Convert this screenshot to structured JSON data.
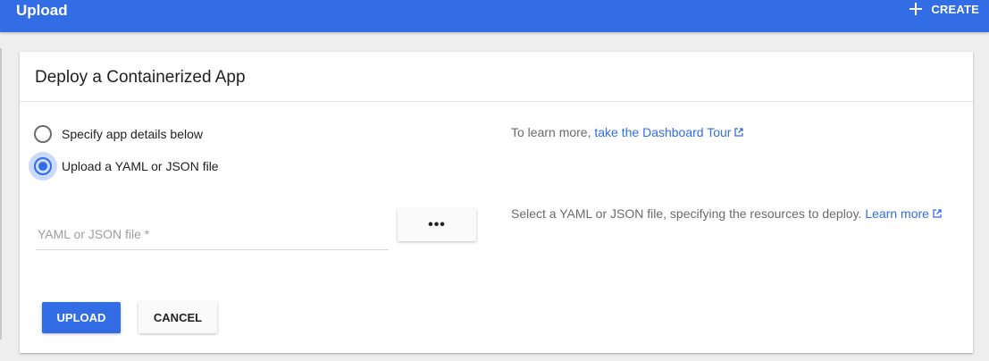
{
  "header": {
    "title": "Upload",
    "create_label": "CREATE",
    "color": "#326de6"
  },
  "card": {
    "title": "Deploy a Containerized App"
  },
  "options": [
    {
      "label": "Specify app details below",
      "checked": false
    },
    {
      "label": "Upload a YAML or JSON file",
      "checked": true
    }
  ],
  "tour": {
    "prefix": "To learn more, ",
    "link": "take the Dashboard Tour"
  },
  "file": {
    "placeholder": "YAML or JSON file *",
    "browse_label": "•••",
    "hint": "Select a YAML or JSON file, specifying the resources to deploy. ",
    "learn_more": "Learn more"
  },
  "actions": {
    "upload": "UPLOAD",
    "cancel": "CANCEL"
  }
}
